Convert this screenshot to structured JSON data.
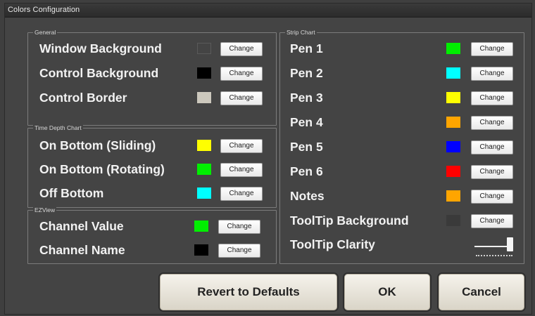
{
  "window": {
    "title": "Colors Configuration"
  },
  "change_label": "Change",
  "general": {
    "title": "General",
    "rows": [
      {
        "label": "Window Background",
        "color": "#444444"
      },
      {
        "label": "Control Background",
        "color": "#000000"
      },
      {
        "label": "Control Border",
        "color": "#ccc8bd"
      }
    ]
  },
  "time_depth": {
    "title": "Time Depth Chart",
    "rows": [
      {
        "label": "On Bottom (Sliding)",
        "color": "#ffff00"
      },
      {
        "label": "On Bottom (Rotating)",
        "color": "#00ee00"
      },
      {
        "label": "Off Bottom",
        "color": "#00ffff"
      }
    ]
  },
  "ezview": {
    "title": "EZView",
    "rows": [
      {
        "label": "Channel Value",
        "color": "#00ee00"
      },
      {
        "label": "Channel Name",
        "color": "#000000"
      }
    ]
  },
  "strip_chart": {
    "title": "Strip Chart",
    "rows": [
      {
        "label": "Pen 1",
        "color": "#00ee00"
      },
      {
        "label": "Pen 2",
        "color": "#00ffff"
      },
      {
        "label": "Pen 3",
        "color": "#ffff00"
      },
      {
        "label": "Pen 4",
        "color": "#ffa500"
      },
      {
        "label": "Pen 5",
        "color": "#0000ff"
      },
      {
        "label": "Pen 6",
        "color": "#ff0000"
      },
      {
        "label": "Notes",
        "color": "#ffa500"
      },
      {
        "label": "ToolTip Background",
        "color": "#3a3a3a"
      }
    ],
    "clarity_label": "ToolTip Clarity",
    "clarity_value": 0.95
  },
  "buttons": {
    "revert": "Revert to Defaults",
    "ok": "OK",
    "cancel": "Cancel"
  }
}
